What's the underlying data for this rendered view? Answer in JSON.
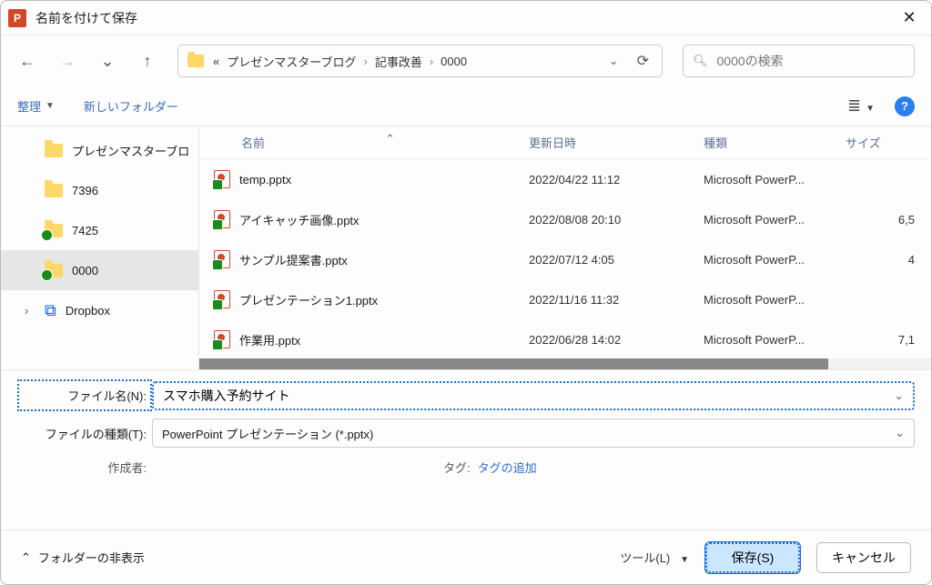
{
  "window": {
    "title": "名前を付けて保存",
    "app_badge": "P"
  },
  "nav": {
    "breadcrumb_parts": [
      "«",
      "プレゼンマスターブログ",
      "記事改善",
      "0000"
    ],
    "search_placeholder": "0000の検索"
  },
  "toolbar": {
    "organize": "整理",
    "new_folder": "新しいフォルダー"
  },
  "sidebar": {
    "items": [
      {
        "label": "プレゼンマスターブロ",
        "sync": false
      },
      {
        "label": "7396",
        "sync": false
      },
      {
        "label": "7425",
        "sync": true
      },
      {
        "label": "0000",
        "sync": true,
        "selected": true
      }
    ],
    "dropbox": "Dropbox"
  },
  "columns": {
    "name": "名前",
    "date": "更新日時",
    "type": "種類",
    "size": "サイズ"
  },
  "files": [
    {
      "name": "temp.pptx",
      "date": "2022/04/22 11:12",
      "type": "Microsoft PowerP...",
      "size": ""
    },
    {
      "name": "アイキャッチ画像.pptx",
      "date": "2022/08/08 20:10",
      "type": "Microsoft PowerP...",
      "size": "6,5"
    },
    {
      "name": "サンプル提案書.pptx",
      "date": "2022/07/12 4:05",
      "type": "Microsoft PowerP...",
      "size": "4"
    },
    {
      "name": "プレゼンテーション1.pptx",
      "date": "2022/11/16 11:32",
      "type": "Microsoft PowerP...",
      "size": ""
    },
    {
      "name": "作業用.pptx",
      "date": "2022/06/28 14:02",
      "type": "Microsoft PowerP...",
      "size": "7,1"
    }
  ],
  "form": {
    "filename_label": "ファイル名(N):",
    "filename_value": "スマホ購入予約サイト",
    "filetype_label": "ファイルの種類(T):",
    "filetype_value": "PowerPoint プレゼンテーション (*.pptx)",
    "author_label": "作成者:",
    "tag_label": "タグ:",
    "tag_add": "タグの追加"
  },
  "footer": {
    "hide_folders": "フォルダーの非表示",
    "tools": "ツール(L)",
    "save": "保存(S)",
    "cancel": "キャンセル"
  }
}
